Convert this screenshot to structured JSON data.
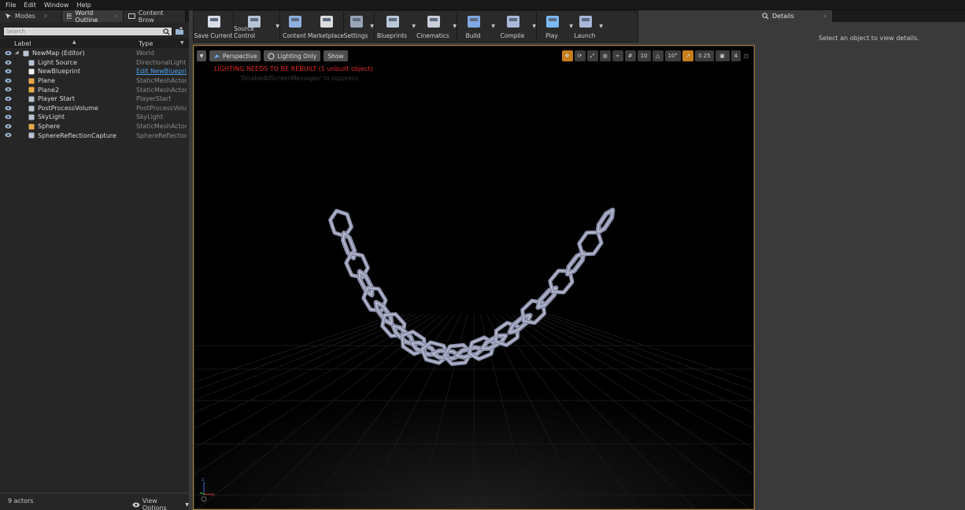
{
  "menu": [
    "File",
    "Edit",
    "Window",
    "Help"
  ],
  "left_tabs": [
    {
      "label": "Modes",
      "icon": "modes-icon"
    },
    {
      "label": "World Outline",
      "icon": "world-outliner-icon"
    },
    {
      "label": "Content Brow",
      "icon": "content-browser-icon"
    }
  ],
  "outliner": {
    "search_placeholder": "Search",
    "col_label": "Label",
    "col_type": "Type",
    "rows": [
      {
        "label": "NewMap (Editor)",
        "type": "World",
        "icon": "world-icon",
        "indent": 0
      },
      {
        "label": "Light Source",
        "type": "DirectionalLight",
        "icon": "directional-light-icon",
        "indent": 1
      },
      {
        "label": "NewBlueprint",
        "type": "Edit NewBlueprin",
        "icon": "blueprint-icon",
        "indent": 1,
        "link": true
      },
      {
        "label": "Plane",
        "type": "StaticMeshActor",
        "icon": "static-mesh-icon",
        "indent": 1
      },
      {
        "label": "Plane2",
        "type": "StaticMeshActor",
        "icon": "static-mesh-icon",
        "indent": 1
      },
      {
        "label": "Player Start",
        "type": "PlayerStart",
        "icon": "player-start-icon",
        "indent": 1
      },
      {
        "label": "PostProcessVolume",
        "type": "PostProcessVolum",
        "icon": "post-process-icon",
        "indent": 1
      },
      {
        "label": "SkyLight",
        "type": "SkyLight",
        "icon": "skylight-icon",
        "indent": 1
      },
      {
        "label": "Sphere",
        "type": "StaticMeshActor",
        "icon": "static-mesh-icon",
        "indent": 1
      },
      {
        "label": "SphereReflectionCapture",
        "type": "SphereReflectionC",
        "icon": "reflection-capture-icon",
        "indent": 1
      }
    ],
    "actor_count": "9 actors",
    "view_options": "View Options"
  },
  "toolbar": [
    {
      "label": "Save Current",
      "icon": "save-icon",
      "dropdown": false
    },
    {
      "label": "Source Control",
      "icon": "source-control-icon",
      "dropdown": true
    },
    {
      "label": "Content",
      "icon": "content-icon",
      "dropdown": false
    },
    {
      "label": "Marketplace",
      "icon": "marketplace-icon",
      "dropdown": false
    },
    {
      "label": "Settings",
      "icon": "settings-icon",
      "dropdown": true
    },
    {
      "label": "Blueprints",
      "icon": "blueprints-icon",
      "dropdown": true
    },
    {
      "label": "Cinematics",
      "icon": "cinematics-icon",
      "dropdown": true
    },
    {
      "label": "Build",
      "icon": "build-icon",
      "dropdown": true
    },
    {
      "label": "Compile",
      "icon": "compile-icon",
      "dropdown": true
    },
    {
      "label": "Play",
      "icon": "play-icon",
      "dropdown": true
    },
    {
      "label": "Launch",
      "icon": "launch-icon",
      "dropdown": true
    }
  ],
  "viewport": {
    "perspective": "Perspective",
    "lighting_only": "Lighting Only",
    "show": "Show",
    "grid_snap": "10",
    "rotation_snap": "10°",
    "scale_snap": "0.25",
    "camera_speed": "4",
    "warning": "LIGHTING NEEDS TO BE REBUILT (1 unbuilt object)",
    "warning_sub": "'DisableAllScreenMessages' to suppress"
  },
  "details": {
    "tab": "Details",
    "empty_message": "Select an object to view details."
  },
  "colors": {
    "accent_orange": "#c77e1c",
    "warning_red": "#e32a2a",
    "link_blue": "#4e9ee6",
    "chain_link": "#8a8ea8"
  }
}
